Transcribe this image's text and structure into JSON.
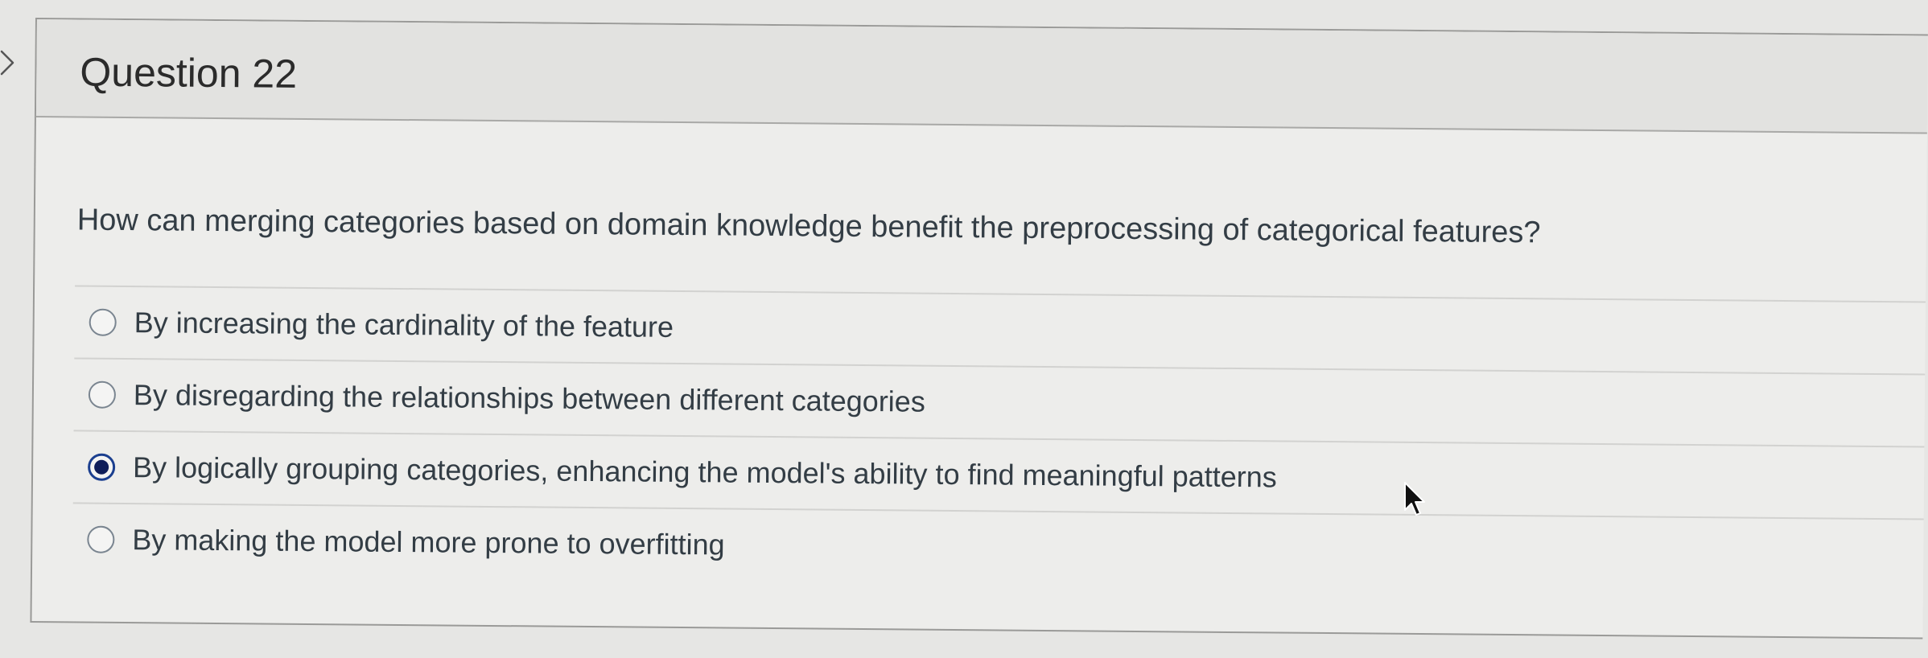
{
  "question": {
    "title": "Question 22",
    "text": "How can merging categories based on domain knowledge benefit the preprocessing of categorical features?",
    "answers": [
      {
        "label": "By increasing the cardinality of the feature",
        "selected": false
      },
      {
        "label": "By disregarding the relationships between different categories",
        "selected": false
      },
      {
        "label": "By logically grouping categories, enhancing the model's ability to find meaningful patterns",
        "selected": true
      },
      {
        "label": "By making the model more prone to overfitting",
        "selected": false
      }
    ]
  },
  "icons": {
    "nav": "chevron-right-icon",
    "pointer": "mouse-cursor-icon"
  },
  "colors": {
    "page_background": "#e6e6e4",
    "card_background": "#ededeb",
    "header_background": "#e2e2e0",
    "selected_radio": "#0f1e5a",
    "text": "#333d45"
  }
}
